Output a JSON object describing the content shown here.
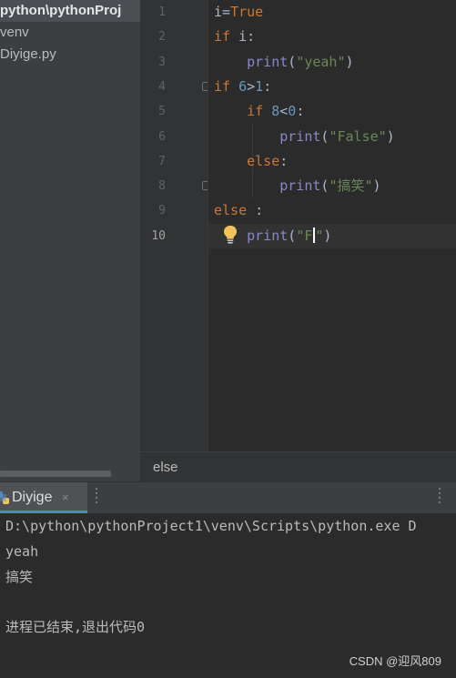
{
  "project_panel": {
    "root_label": "python\\pythonProj",
    "items": [
      "venv",
      "Diyige.py"
    ]
  },
  "editor": {
    "line_numbers": [
      "1",
      "2",
      "3",
      "4",
      "5",
      "6",
      "7",
      "8",
      "9",
      "10"
    ],
    "lines": [
      [
        {
          "t": "i=",
          "c": "plain"
        },
        {
          "t": "True",
          "c": "kw"
        }
      ],
      [
        {
          "t": "if",
          "c": "kw"
        },
        {
          "t": " i:",
          "c": "plain"
        }
      ],
      [
        {
          "t": "    ",
          "c": "plain"
        },
        {
          "t": "print",
          "c": "bi"
        },
        {
          "t": "(",
          "c": "plain"
        },
        {
          "t": "\"yeah\"",
          "c": "str"
        },
        {
          "t": ")",
          "c": "plain"
        }
      ],
      [
        {
          "t": "if",
          "c": "kw"
        },
        {
          "t": " ",
          "c": "plain"
        },
        {
          "t": "6",
          "c": "num"
        },
        {
          "t": ">",
          "c": "plain"
        },
        {
          "t": "1",
          "c": "num"
        },
        {
          "t": ":",
          "c": "plain"
        }
      ],
      [
        {
          "t": "    ",
          "c": "plain"
        },
        {
          "t": "if",
          "c": "kw"
        },
        {
          "t": " ",
          "c": "plain"
        },
        {
          "t": "8",
          "c": "num"
        },
        {
          "t": "<",
          "c": "plain"
        },
        {
          "t": "0",
          "c": "num"
        },
        {
          "t": ":",
          "c": "plain"
        }
      ],
      [
        {
          "t": "        ",
          "c": "plain"
        },
        {
          "t": "print",
          "c": "bi"
        },
        {
          "t": "(",
          "c": "plain"
        },
        {
          "t": "\"False\"",
          "c": "str"
        },
        {
          "t": ")",
          "c": "plain"
        }
      ],
      [
        {
          "t": "    ",
          "c": "plain"
        },
        {
          "t": "else",
          "c": "kw"
        },
        {
          "t": ":",
          "c": "plain"
        }
      ],
      [
        {
          "t": "        ",
          "c": "plain"
        },
        {
          "t": "print",
          "c": "bi"
        },
        {
          "t": "(",
          "c": "plain"
        },
        {
          "t": "\"搞笑\"",
          "c": "str"
        },
        {
          "t": ")",
          "c": "plain"
        }
      ],
      [
        {
          "t": "else",
          "c": "kw"
        },
        {
          "t": " :",
          "c": "plain"
        }
      ],
      [
        {
          "t": "    ",
          "c": "plain"
        },
        {
          "t": "print",
          "c": "bi"
        },
        {
          "t": "(",
          "c": "plain"
        },
        {
          "t": "\"F",
          "c": "str"
        },
        {
          "t": "|caret|",
          "c": "caret"
        },
        {
          "t": "\"",
          "c": "str"
        },
        {
          "t": ")",
          "c": "plain"
        }
      ]
    ],
    "current_line": 10,
    "intention_icon": "lightbulb-icon"
  },
  "breadcrumb": {
    "label": "else"
  },
  "run_panel": {
    "tab_label": "Diyige",
    "tab_icon": "python-file-icon",
    "close_glyph": "×",
    "output": [
      "D:\\python\\pythonProject1\\venv\\Scripts\\python.exe D",
      "yeah",
      "搞笑",
      "",
      "进程已结束,退出代码0"
    ]
  },
  "watermark": "CSDN @迎风809",
  "colors": {
    "keyword": "#cc7832",
    "builtin": "#8888c6",
    "number": "#6897bb",
    "string": "#6a8759",
    "text": "#a9b7c6",
    "bulb": "#f2c55c",
    "tab_accent": "#4a88c7"
  }
}
